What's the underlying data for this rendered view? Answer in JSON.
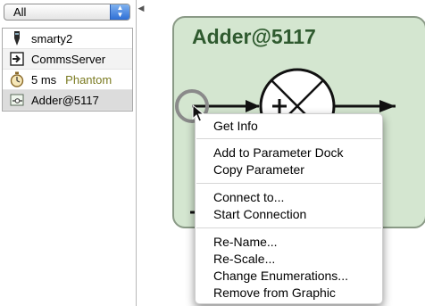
{
  "filter": {
    "selected": "All"
  },
  "node_list": [
    {
      "label": "smarty2",
      "icon": "pen-icon"
    },
    {
      "label": "CommsServer",
      "icon": "exit-arrow-icon"
    },
    {
      "label": "5 ms",
      "status": "Phantom",
      "icon": "stopwatch-icon"
    },
    {
      "label": "Adder@5117",
      "icon": "adder-block-icon"
    }
  ],
  "block": {
    "title": "Adder@5117"
  },
  "context_menu": {
    "items": [
      "Get Info",
      "Add to Parameter Dock",
      "Copy Parameter",
      "Connect to...",
      "Start Connection",
      "Re-Name...",
      "Re-Scale...",
      "Change Enumerations...",
      "Remove from Graphic"
    ]
  },
  "colors": {
    "block_fill": "#d4e6d0",
    "block_title": "#2f5a2f",
    "phantom_text": "#7a7a20",
    "select_arrow": "#2e6fd6"
  }
}
